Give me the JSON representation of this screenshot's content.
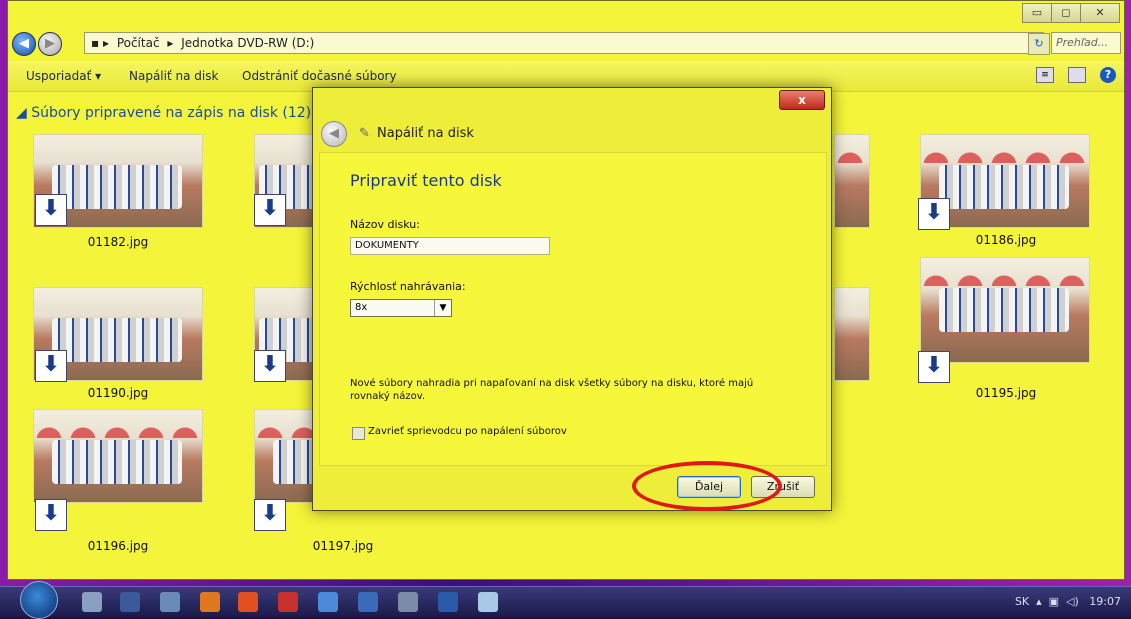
{
  "window": {
    "buttons": {
      "minimize": "▭",
      "maximize": "◻",
      "close": "✕"
    }
  },
  "address": {
    "segments": [
      "Počítač",
      "Jednotka DVD-RW (D:)"
    ],
    "search_placeholder": "Prehľad..."
  },
  "toolbar": {
    "organize": "Usporiadať ▾",
    "burn": "Napáliť na disk",
    "delete_temp": "Odstrániť dočasné súbory"
  },
  "group": {
    "header": "Súbory pripravené na zápis na disk (12)"
  },
  "files": [
    {
      "name": "01182.jpg"
    },
    {
      "name": "01186.jpg"
    },
    {
      "name": "01190.jpg"
    },
    {
      "name": "01195.jpg"
    },
    {
      "name": "01196.jpg"
    },
    {
      "name": "01197.jpg"
    }
  ],
  "dialog": {
    "close": "x",
    "title": "Napáliť na disk",
    "heading": "Pripraviť tento disk",
    "disk_name_label": "Názov disku:",
    "disk_name_value": "DOKUMENTY",
    "speed_label": "Rýchlosť nahrávania:",
    "speed_value": "8x",
    "note": "Nové súbory nahradia pri napaľovaní na disk všetky súbory na disku, ktoré majú rovnaký názov.",
    "close_wizard_label": "Zavrieť sprievodcu po napálení súborov",
    "next_button": "Ďalej",
    "cancel_button": "Zrušiť"
  },
  "tray": {
    "lang": "SK",
    "time": "19:07"
  },
  "colors": {
    "window_bg": "#f4f43a",
    "accent": "#1a4ea0",
    "highlight_ring": "#e01818"
  },
  "icons": [
    "back-arrow-icon",
    "forward-arrow-icon",
    "folder-icon",
    "refresh-icon",
    "search-icon",
    "view-icon",
    "preview-pane-icon",
    "help-icon",
    "download-arrow-icon",
    "burn-disc-icon",
    "start-orb-icon"
  ]
}
